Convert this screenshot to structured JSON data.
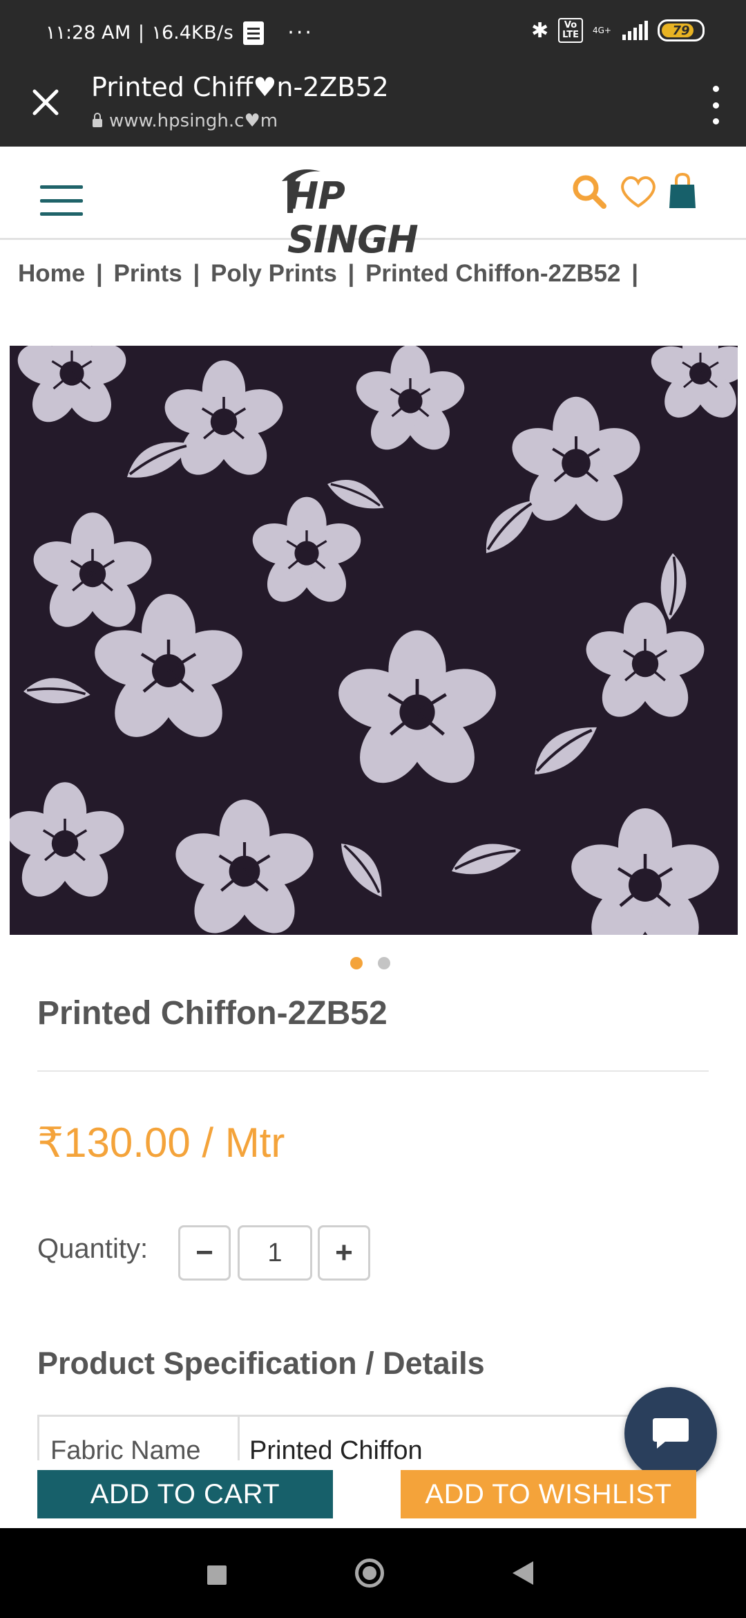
{
  "status_bar": {
    "time": "١١:28 AM",
    "speed": "١6.4KB/s",
    "dots": "···",
    "bluetooth": "✱",
    "volte_top": "Vo",
    "volte_bottom": "LTE",
    "network": "4G+",
    "battery": "79",
    "battery_color": "#e8b323"
  },
  "tab": {
    "title": "Printed Chiff♥n-2ZB52",
    "url": "www.hpsingh.c♥m"
  },
  "header": {
    "logo_text": "HP SINGH",
    "accent_color": "#f4a33a",
    "brand_color": "#17606a"
  },
  "breadcrumb": {
    "items": [
      "Home",
      "Prints",
      "Poly Prints",
      "Printed Chiffon-2ZB52"
    ],
    "separator": "|"
  },
  "product": {
    "title": "Printed Chiffon-2ZB52",
    "price": "₹130.00 / Mtr",
    "image_count": 2,
    "active_image": 1
  },
  "quantity": {
    "label": "Quantity:",
    "value": "1",
    "minus": "−",
    "plus": "+"
  },
  "specs": {
    "heading": "Product Specification / Details",
    "rows": [
      {
        "key": "Fabric Name",
        "value": "Printed Chiffon"
      }
    ]
  },
  "actions": {
    "add_to_cart": "ADD TO CART",
    "add_to_wishlist": "ADD TO WISHLIST"
  }
}
